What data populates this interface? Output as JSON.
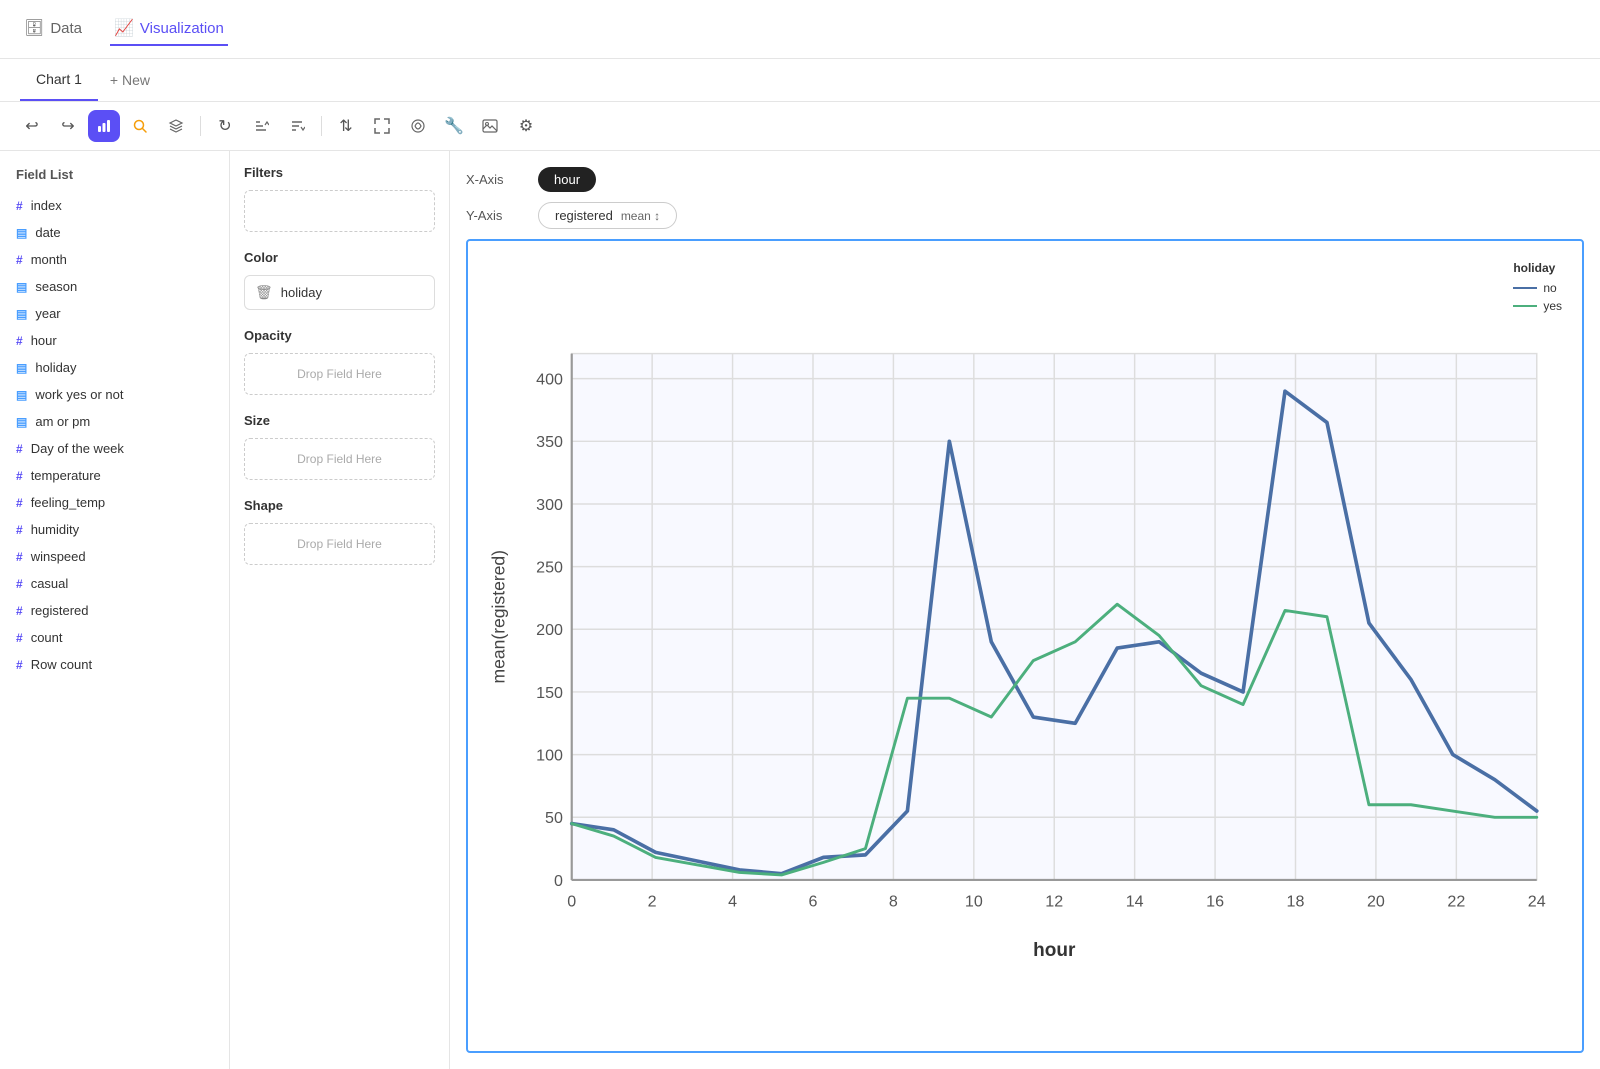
{
  "nav": {
    "tabs": [
      {
        "id": "data",
        "label": "Data",
        "icon": "🗄",
        "active": false
      },
      {
        "id": "visualization",
        "label": "Visualization",
        "icon": "📈",
        "active": true
      }
    ]
  },
  "chart_tabs": {
    "tabs": [
      {
        "id": "chart1",
        "label": "Chart 1",
        "active": true
      }
    ],
    "new_tab_label": "+ New"
  },
  "toolbar": {
    "buttons": [
      {
        "id": "undo",
        "icon": "↩",
        "label": "Undo",
        "active": false
      },
      {
        "id": "redo",
        "icon": "↪",
        "label": "Redo",
        "active": false
      },
      {
        "id": "chart-type",
        "icon": "⬡",
        "label": "Chart Type",
        "active": true
      },
      {
        "id": "search",
        "icon": "🔍",
        "label": "Search",
        "active": false
      },
      {
        "id": "layers",
        "icon": "⊞",
        "label": "Layers",
        "active": false
      },
      {
        "id": "divider1"
      },
      {
        "id": "refresh",
        "icon": "↻",
        "label": "Refresh",
        "active": false
      },
      {
        "id": "sort-asc",
        "icon": "⇈",
        "label": "Sort Ascending",
        "active": false
      },
      {
        "id": "sort-desc",
        "icon": "⇊",
        "label": "Sort Descending",
        "active": false
      },
      {
        "id": "divider2"
      },
      {
        "id": "up-down",
        "icon": "⇅",
        "label": "Up Down",
        "active": false
      },
      {
        "id": "expand",
        "icon": "⤢",
        "label": "Expand",
        "active": false
      },
      {
        "id": "transform",
        "icon": "⤿",
        "label": "Transform",
        "active": false
      },
      {
        "id": "wrench",
        "icon": "🔧",
        "label": "Wrench",
        "active": false
      },
      {
        "id": "image",
        "icon": "🖼",
        "label": "Image",
        "active": false
      },
      {
        "id": "settings",
        "icon": "⚙",
        "label": "Settings",
        "active": false
      }
    ]
  },
  "field_list": {
    "title": "Field List",
    "fields": [
      {
        "id": "index",
        "name": "index",
        "type": "numeric"
      },
      {
        "id": "date",
        "name": "date",
        "type": "categorical"
      },
      {
        "id": "month",
        "name": "month",
        "type": "numeric"
      },
      {
        "id": "season",
        "name": "season",
        "type": "categorical"
      },
      {
        "id": "year",
        "name": "year",
        "type": "categorical"
      },
      {
        "id": "hour",
        "name": "hour",
        "type": "numeric"
      },
      {
        "id": "holiday",
        "name": "holiday",
        "type": "categorical"
      },
      {
        "id": "work-yes-or-not",
        "name": "work yes or not",
        "type": "categorical"
      },
      {
        "id": "am-or-pm",
        "name": "am or pm",
        "type": "categorical"
      },
      {
        "id": "day-of-week",
        "name": "Day of the week",
        "type": "numeric"
      },
      {
        "id": "temperature",
        "name": "temperature",
        "type": "numeric"
      },
      {
        "id": "feeling-temp",
        "name": "feeling_temp",
        "type": "numeric"
      },
      {
        "id": "humidity",
        "name": "humidity",
        "type": "numeric"
      },
      {
        "id": "winspeed",
        "name": "winspeed",
        "type": "numeric"
      },
      {
        "id": "casual",
        "name": "casual",
        "type": "numeric"
      },
      {
        "id": "registered",
        "name": "registered",
        "type": "numeric"
      },
      {
        "id": "count",
        "name": "count",
        "type": "numeric"
      },
      {
        "id": "row-count",
        "name": "Row count",
        "type": "numeric"
      }
    ]
  },
  "filters": {
    "title": "Filters",
    "drop_hint": ""
  },
  "color": {
    "title": "Color",
    "value": "holiday"
  },
  "opacity": {
    "title": "Opacity",
    "drop_hint": "Drop Field Here"
  },
  "size": {
    "title": "Size",
    "drop_hint": "Drop Field Here"
  },
  "shape": {
    "title": "Shape",
    "drop_hint": "Drop Field Here"
  },
  "xaxis": {
    "label": "X-Axis",
    "value": "hour"
  },
  "yaxis": {
    "label": "Y-Axis",
    "field": "registered",
    "agg": "mean ↕"
  },
  "chart": {
    "y_axis_label": "mean(registered)",
    "x_axis_label": "hour",
    "legend_title": "holiday",
    "legend_items": [
      {
        "label": "no",
        "color": "#4a6fa5"
      },
      {
        "label": "yes",
        "color": "#4caf7d"
      }
    ],
    "no_data": [
      45,
      40,
      22,
      15,
      8,
      5,
      18,
      20,
      55,
      350,
      190,
      130,
      125,
      185,
      190,
      165,
      150,
      390,
      365,
      205,
      160,
      100,
      80,
      55
    ],
    "yes_data": [
      45,
      35,
      18,
      12,
      6,
      4,
      14,
      25,
      145,
      145,
      130,
      175,
      190,
      220,
      195,
      155,
      140,
      215,
      210,
      60,
      60,
      55,
      50,
      50
    ]
  }
}
